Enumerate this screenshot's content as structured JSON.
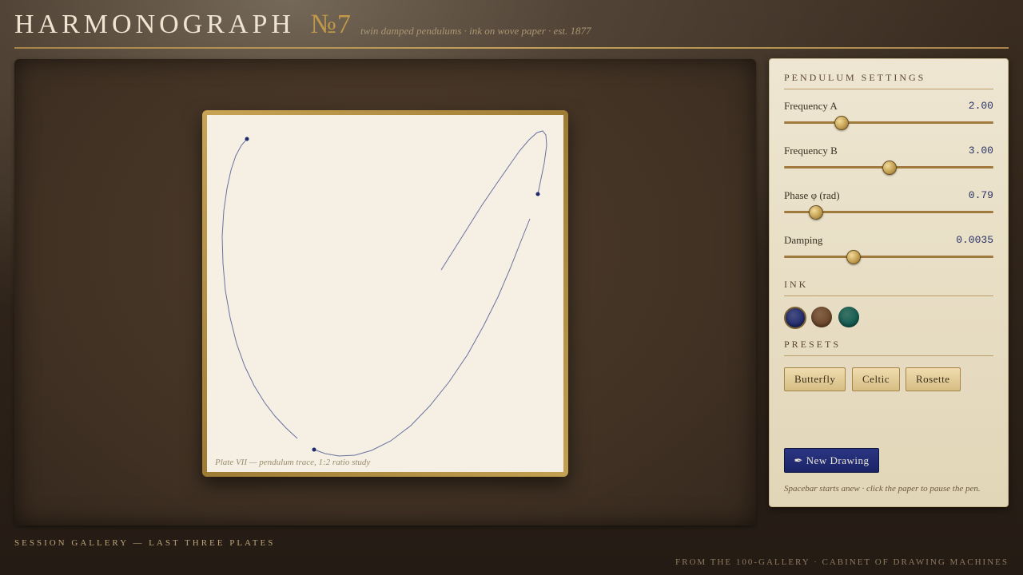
{
  "header": {
    "title": "HARMONOGRAPH",
    "number": "№7",
    "subtitle": "twin damped pendulums · ink on wove paper · est. 1877"
  },
  "canvas": {
    "caption": "Plate VII — pendulum trace, 1:2 ratio study",
    "ink_color": "#2a3266"
  },
  "settings": {
    "title": "PENDULUM SETTINGS",
    "sliders": [
      {
        "label": "Frequency A",
        "value": "2.00",
        "fraction": 0.27
      },
      {
        "label": "Frequency B",
        "value": "3.00",
        "fraction": 0.5
      },
      {
        "label": "Phase φ (rad)",
        "value": "0.79",
        "fraction": 0.15
      },
      {
        "label": "Damping",
        "value": "0.0035",
        "fraction": 0.33
      }
    ]
  },
  "ink": {
    "title": "INK",
    "swatches": [
      {
        "name": "indigo",
        "color": "#1f2a6e",
        "selected": true
      },
      {
        "name": "sepia",
        "color": "#6b4428",
        "selected": false
      },
      {
        "name": "teal",
        "color": "#11594f",
        "selected": false
      }
    ]
  },
  "presets": {
    "title": "PRESETS",
    "items": [
      "Butterfly",
      "Celtic",
      "Rosette"
    ]
  },
  "actions": {
    "new_drawing": "✒ New Drawing",
    "hint": "Spacebar starts anew · click the paper to pause the pen."
  },
  "gallery": {
    "title": "SESSION GALLERY — LAST THREE PLATES"
  },
  "footer": {
    "text": "FROM THE 100-GALLERY · CABINET OF DRAWING MACHINES"
  }
}
